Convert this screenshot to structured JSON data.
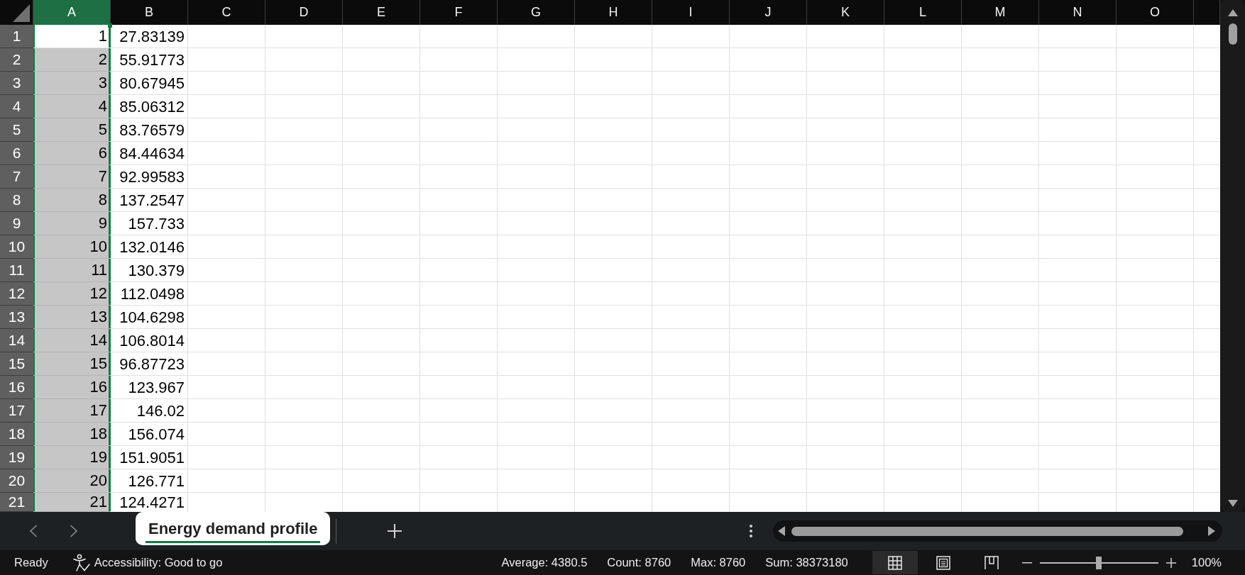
{
  "columns": [
    {
      "label": "A",
      "selected": true
    },
    {
      "label": "B",
      "selected": false
    },
    {
      "label": "C",
      "selected": false
    },
    {
      "label": "D",
      "selected": false
    },
    {
      "label": "E",
      "selected": false
    },
    {
      "label": "F",
      "selected": false
    },
    {
      "label": "G",
      "selected": false
    },
    {
      "label": "H",
      "selected": false
    },
    {
      "label": "I",
      "selected": false
    },
    {
      "label": "J",
      "selected": false
    },
    {
      "label": "K",
      "selected": false
    },
    {
      "label": "L",
      "selected": false
    },
    {
      "label": "M",
      "selected": false
    },
    {
      "label": "N",
      "selected": false
    },
    {
      "label": "O",
      "selected": false
    }
  ],
  "rows": [
    {
      "label": "1",
      "highlighted": true,
      "cells": [
        {
          "value": "1",
          "selected": true,
          "active": true
        },
        {
          "value": "27.83139",
          "selected": false,
          "active": false
        }
      ]
    },
    {
      "label": "2",
      "highlighted": true,
      "cells": [
        {
          "value": "2",
          "selected": true,
          "active": false
        },
        {
          "value": "55.91773",
          "selected": false,
          "active": false
        }
      ]
    },
    {
      "label": "3",
      "highlighted": true,
      "cells": [
        {
          "value": "3",
          "selected": true,
          "active": false
        },
        {
          "value": "80.67945",
          "selected": false,
          "active": false
        }
      ]
    },
    {
      "label": "4",
      "highlighted": true,
      "cells": [
        {
          "value": "4",
          "selected": true,
          "active": false
        },
        {
          "value": "85.06312",
          "selected": false,
          "active": false
        }
      ]
    },
    {
      "label": "5",
      "highlighted": true,
      "cells": [
        {
          "value": "5",
          "selected": true,
          "active": false
        },
        {
          "value": "83.76579",
          "selected": false,
          "active": false
        }
      ]
    },
    {
      "label": "6",
      "highlighted": true,
      "cells": [
        {
          "value": "6",
          "selected": true,
          "active": false
        },
        {
          "value": "84.44634",
          "selected": false,
          "active": false
        }
      ]
    },
    {
      "label": "7",
      "highlighted": true,
      "cells": [
        {
          "value": "7",
          "selected": true,
          "active": false
        },
        {
          "value": "92.99583",
          "selected": false,
          "active": false
        }
      ]
    },
    {
      "label": "8",
      "highlighted": true,
      "cells": [
        {
          "value": "8",
          "selected": true,
          "active": false
        },
        {
          "value": "137.2547",
          "selected": false,
          "active": false
        }
      ]
    },
    {
      "label": "9",
      "highlighted": true,
      "cells": [
        {
          "value": "9",
          "selected": true,
          "active": false
        },
        {
          "value": "157.733",
          "selected": false,
          "active": false
        }
      ]
    },
    {
      "label": "10",
      "highlighted": true,
      "cells": [
        {
          "value": "10",
          "selected": true,
          "active": false
        },
        {
          "value": "132.0146",
          "selected": false,
          "active": false
        }
      ]
    },
    {
      "label": "11",
      "highlighted": true,
      "cells": [
        {
          "value": "11",
          "selected": true,
          "active": false
        },
        {
          "value": "130.379",
          "selected": false,
          "active": false
        }
      ]
    },
    {
      "label": "12",
      "highlighted": true,
      "cells": [
        {
          "value": "12",
          "selected": true,
          "active": false
        },
        {
          "value": "112.0498",
          "selected": false,
          "active": false
        }
      ]
    },
    {
      "label": "13",
      "highlighted": true,
      "cells": [
        {
          "value": "13",
          "selected": true,
          "active": false
        },
        {
          "value": "104.6298",
          "selected": false,
          "active": false
        }
      ]
    },
    {
      "label": "14",
      "highlighted": true,
      "cells": [
        {
          "value": "14",
          "selected": true,
          "active": false
        },
        {
          "value": "106.8014",
          "selected": false,
          "active": false
        }
      ]
    },
    {
      "label": "15",
      "highlighted": true,
      "cells": [
        {
          "value": "15",
          "selected": true,
          "active": false
        },
        {
          "value": "96.87723",
          "selected": false,
          "active": false
        }
      ]
    },
    {
      "label": "16",
      "highlighted": true,
      "cells": [
        {
          "value": "16",
          "selected": true,
          "active": false
        },
        {
          "value": "123.967",
          "selected": false,
          "active": false
        }
      ]
    },
    {
      "label": "17",
      "highlighted": true,
      "cells": [
        {
          "value": "17",
          "selected": true,
          "active": false
        },
        {
          "value": "146.02",
          "selected": false,
          "active": false
        }
      ]
    },
    {
      "label": "18",
      "highlighted": true,
      "cells": [
        {
          "value": "18",
          "selected": true,
          "active": false
        },
        {
          "value": "156.074",
          "selected": false,
          "active": false
        }
      ]
    },
    {
      "label": "19",
      "highlighted": true,
      "cells": [
        {
          "value": "19",
          "selected": true,
          "active": false
        },
        {
          "value": "151.9051",
          "selected": false,
          "active": false
        }
      ]
    },
    {
      "label": "20",
      "highlighted": true,
      "cells": [
        {
          "value": "20",
          "selected": true,
          "active": false
        },
        {
          "value": "126.771",
          "selected": false,
          "active": false
        }
      ]
    },
    {
      "label": "21",
      "highlighted": true,
      "cells": [
        {
          "value": "21",
          "selected": true,
          "active": false
        },
        {
          "value": "124.4271",
          "selected": false,
          "active": false
        }
      ]
    }
  ],
  "sheet_tabs": [
    {
      "label": "Energy demand profile",
      "selected": true
    }
  ],
  "status_bar": {
    "mode": "Ready",
    "accessibility": "Accessibility: Good to go",
    "statistics": [
      "Average: 4380.5",
      "Count: 8760",
      "Max: 8760",
      "Sum: 38373180"
    ],
    "views": [
      {
        "kind": "normal",
        "selected": true
      },
      {
        "kind": "page_layout",
        "selected": false
      },
      {
        "kind": "page_break",
        "selected": false
      }
    ],
    "zoom": {
      "level": 0.5,
      "reading": "100%"
    }
  }
}
